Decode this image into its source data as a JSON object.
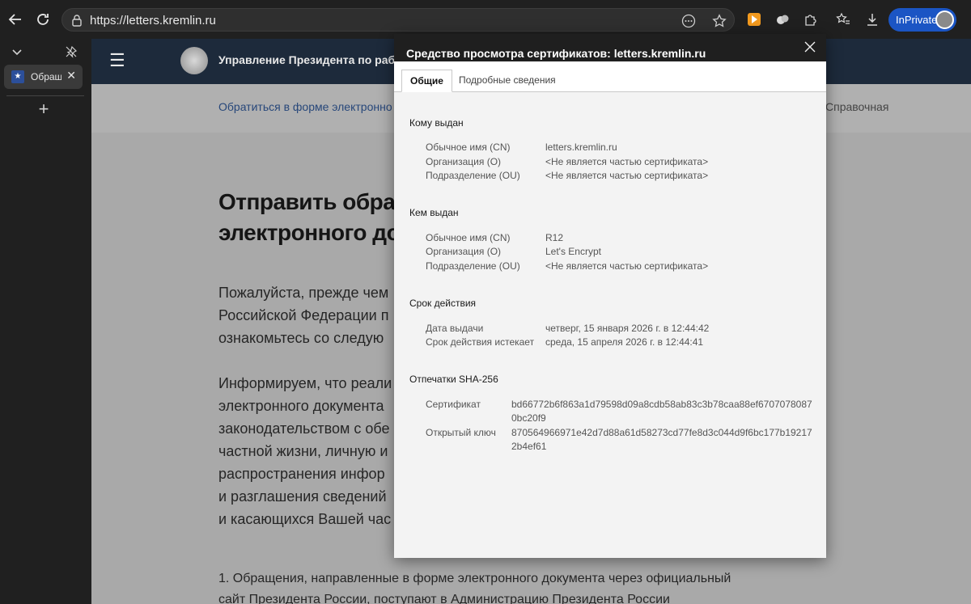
{
  "browser": {
    "url": "https://letters.kremlin.ru",
    "inprivate_label": "InPrivate"
  },
  "tabs": [
    {
      "title": "Обращ"
    }
  ],
  "site": {
    "org_name": "Управление Президента по раб",
    "subnav_link": "Обратиться в форме электронно",
    "subnav_right": "Справочная",
    "heading_line1": "Отправить обращ",
    "heading_line2": "электронного док",
    "para1": [
      "Пожалуйста, прежде чем",
      "Российской Федерации п",
      "ознакомьтесь со следую"
    ],
    "para2": [
      "Информируем, что реали",
      "электронного документа",
      "законодательством с обе",
      "частной жизни, личную и",
      "распространения инфор",
      "и разглашения сведений",
      "и касающихся Вашей час"
    ],
    "bottom_line1": "1. Обращения, направленные в форме электронного документа через официальный",
    "bottom_line2": "сайт Президента России, поступают в Администрацию Президента России"
  },
  "dialog": {
    "title": "Средство просмотра сертификатов: letters.kremlin.ru",
    "tab_general": "Общие",
    "tab_details": "Подробные сведения",
    "issued_to": {
      "heading": "Кому выдан",
      "rows": [
        {
          "label": "Обычное имя (CN)",
          "value": "letters.kremlin.ru"
        },
        {
          "label": "Организация (O)",
          "value": "<Не является частью сертификата>"
        },
        {
          "label": "Подразделение (OU)",
          "value": "<Не является частью сертификата>"
        }
      ]
    },
    "issued_by": {
      "heading": "Кем выдан",
      "rows": [
        {
          "label": "Обычное имя (CN)",
          "value": "R12"
        },
        {
          "label": "Организация (O)",
          "value": "Let's Encrypt"
        },
        {
          "label": "Подразделение (OU)",
          "value": "<Не является частью сертификата>"
        }
      ]
    },
    "validity": {
      "heading": "Срок действия",
      "rows": [
        {
          "label": "Дата выдачи",
          "value": "четверг, 15 января 2026 г. в 12:44:42"
        },
        {
          "label": "Срок действия истекает",
          "value": "среда, 15 апреля 2026 г. в 12:44:41"
        }
      ]
    },
    "fingerprints": {
      "heading": "Отпечатки SHA-256",
      "rows": [
        {
          "label": "Сертификат",
          "value": "bd66772b6f863a1d79598d09a8cdb58ab83c3b78caa88ef67070780870bc20f9"
        },
        {
          "label": "Открытый ключ",
          "value": "870564966971e42d7d88a61d58273cd77fe8d3c044d9f6bc177b192172b4ef61"
        }
      ]
    }
  }
}
